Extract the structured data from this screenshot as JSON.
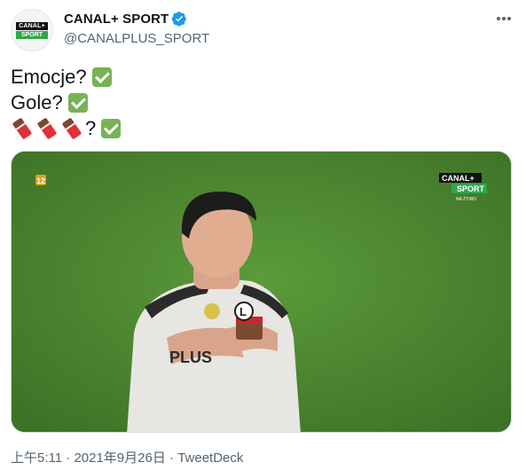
{
  "author": {
    "display_name": "CANAL+ SPORT",
    "handle": "@CANALPLUS_SPORT",
    "avatar_logo_line1": "CANAL+",
    "avatar_logo_line2": "SPORT",
    "verified": true
  },
  "tweet": {
    "lines": [
      "Emocje?",
      "Gole?",
      "?"
    ],
    "line3_prefix_icon": "chocolate-bar-icon",
    "line3_prefix_count": 3,
    "line_suffix_icon": "check-mark-button-icon"
  },
  "media": {
    "age_rating": "12",
    "broadcast_logo_line1": "CANAL+",
    "broadcast_logo_line2": "SPORT",
    "broadcast_logo_sub": "NA ŻYWO",
    "sponsor_jersey_text": "PLUS",
    "crest_letter": "L"
  },
  "footer": {
    "time": "上午5:11",
    "sep1": " · ",
    "date": "2021年9月26日",
    "sep2": " · ",
    "source": "TweetDeck"
  },
  "colors": {
    "verified_blue": "#1d9bf0",
    "check_green": "#77b255",
    "pitch_green": "#3f7a2a",
    "muted_text": "#536471"
  }
}
